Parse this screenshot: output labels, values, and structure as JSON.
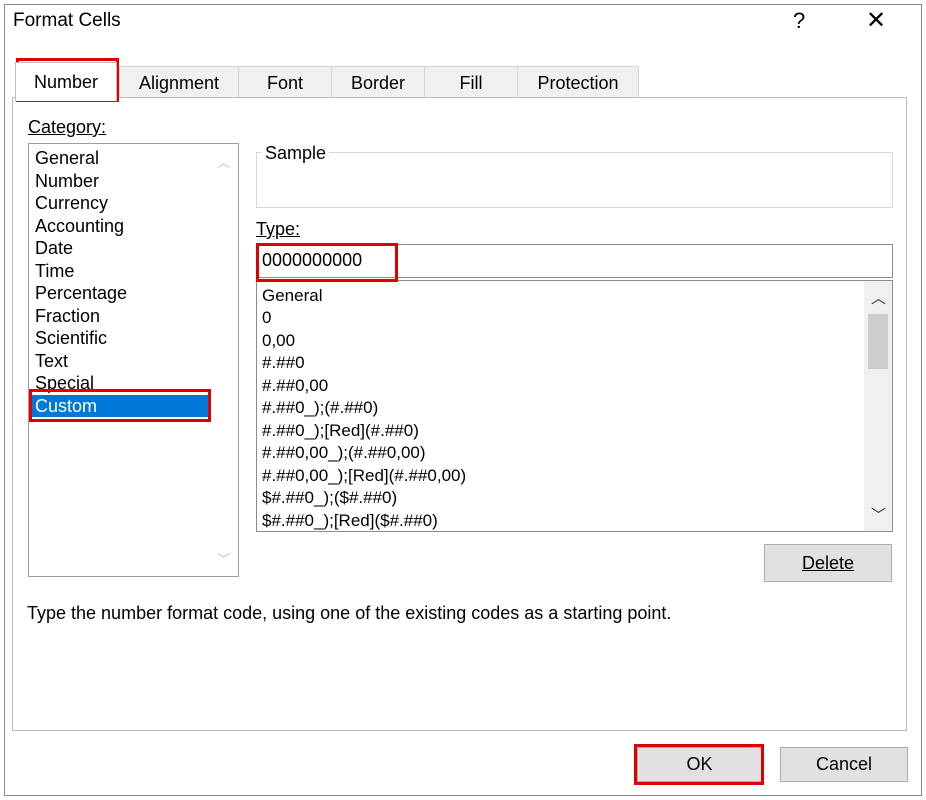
{
  "window": {
    "title": "Format Cells",
    "help_label": "?",
    "close_label": "✕"
  },
  "tabs": [
    "Number",
    "Alignment",
    "Font",
    "Border",
    "Fill",
    "Protection"
  ],
  "active_tab": "Number",
  "category": {
    "label": "Category:",
    "items": [
      "General",
      "Number",
      "Currency",
      "Accounting",
      "Date",
      "Time",
      "Percentage",
      "Fraction",
      "Scientific",
      "Text",
      "Special",
      "Custom"
    ],
    "selected": "Custom"
  },
  "sample": {
    "label": "Sample",
    "value": ""
  },
  "type": {
    "label": "Type:",
    "value": "0000000000",
    "items": [
      "General",
      "0",
      "0,00",
      "#.##0",
      "#.##0,00",
      "#.##0_);(#.##0)",
      "#.##0_);[Red](#.##0)",
      "#.##0,00_);(#.##0,00)",
      "#.##0,00_);[Red](#.##0,00)",
      "$#.##0_);($#.##0)",
      "$#.##0_);[Red]($#.##0)"
    ]
  },
  "buttons": {
    "delete": "Delete",
    "ok": "OK",
    "cancel": "Cancel"
  },
  "description": "Type the number format code, using one of the existing codes as a starting point.",
  "colors": {
    "selection": "#0078d7",
    "highlight": "#e00000"
  }
}
